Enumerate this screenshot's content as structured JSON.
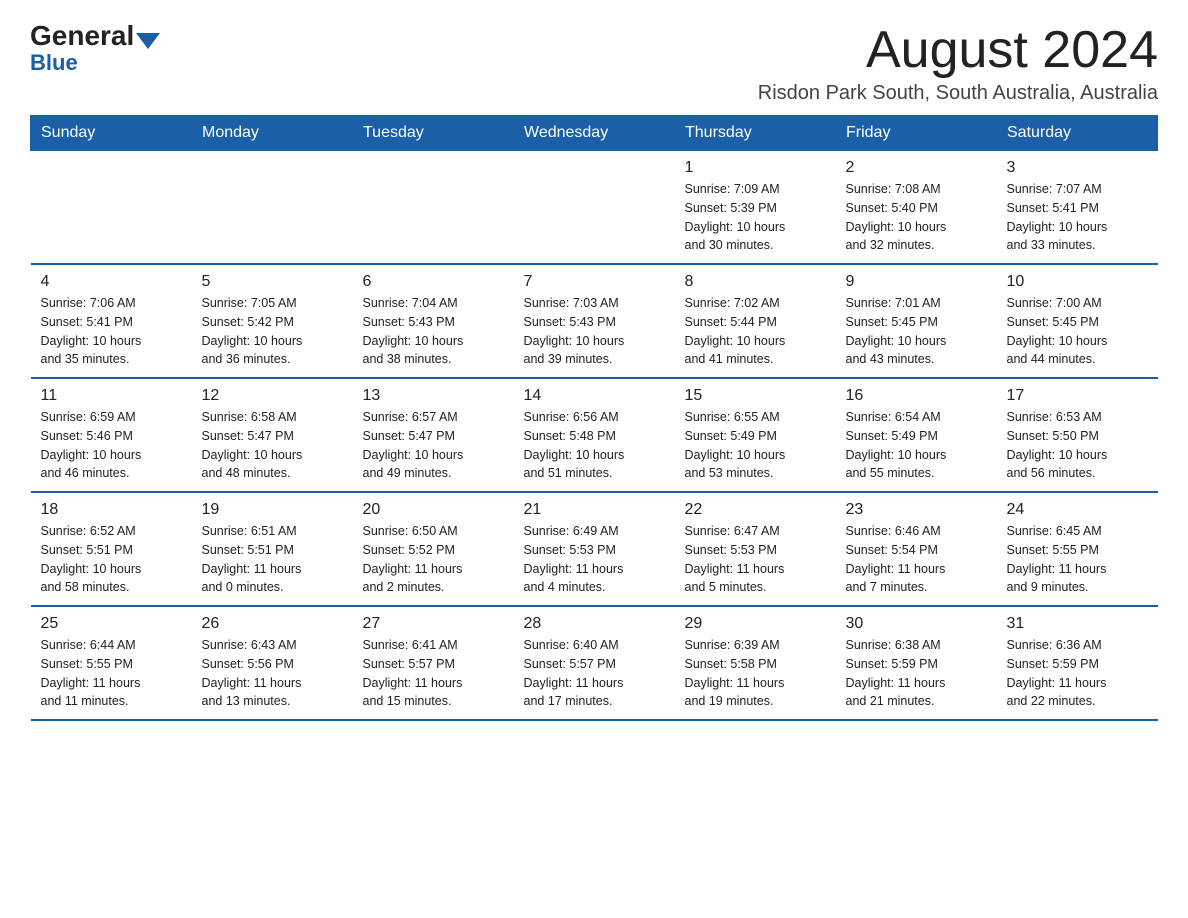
{
  "logo": {
    "general": "General",
    "blue": "Blue"
  },
  "title": "August 2024",
  "location": "Risdon Park South, South Australia, Australia",
  "days_of_week": [
    "Sunday",
    "Monday",
    "Tuesday",
    "Wednesday",
    "Thursday",
    "Friday",
    "Saturday"
  ],
  "weeks": [
    [
      {
        "day": "",
        "info": ""
      },
      {
        "day": "",
        "info": ""
      },
      {
        "day": "",
        "info": ""
      },
      {
        "day": "",
        "info": ""
      },
      {
        "day": "1",
        "info": "Sunrise: 7:09 AM\nSunset: 5:39 PM\nDaylight: 10 hours\nand 30 minutes."
      },
      {
        "day": "2",
        "info": "Sunrise: 7:08 AM\nSunset: 5:40 PM\nDaylight: 10 hours\nand 32 minutes."
      },
      {
        "day": "3",
        "info": "Sunrise: 7:07 AM\nSunset: 5:41 PM\nDaylight: 10 hours\nand 33 minutes."
      }
    ],
    [
      {
        "day": "4",
        "info": "Sunrise: 7:06 AM\nSunset: 5:41 PM\nDaylight: 10 hours\nand 35 minutes."
      },
      {
        "day": "5",
        "info": "Sunrise: 7:05 AM\nSunset: 5:42 PM\nDaylight: 10 hours\nand 36 minutes."
      },
      {
        "day": "6",
        "info": "Sunrise: 7:04 AM\nSunset: 5:43 PM\nDaylight: 10 hours\nand 38 minutes."
      },
      {
        "day": "7",
        "info": "Sunrise: 7:03 AM\nSunset: 5:43 PM\nDaylight: 10 hours\nand 39 minutes."
      },
      {
        "day": "8",
        "info": "Sunrise: 7:02 AM\nSunset: 5:44 PM\nDaylight: 10 hours\nand 41 minutes."
      },
      {
        "day": "9",
        "info": "Sunrise: 7:01 AM\nSunset: 5:45 PM\nDaylight: 10 hours\nand 43 minutes."
      },
      {
        "day": "10",
        "info": "Sunrise: 7:00 AM\nSunset: 5:45 PM\nDaylight: 10 hours\nand 44 minutes."
      }
    ],
    [
      {
        "day": "11",
        "info": "Sunrise: 6:59 AM\nSunset: 5:46 PM\nDaylight: 10 hours\nand 46 minutes."
      },
      {
        "day": "12",
        "info": "Sunrise: 6:58 AM\nSunset: 5:47 PM\nDaylight: 10 hours\nand 48 minutes."
      },
      {
        "day": "13",
        "info": "Sunrise: 6:57 AM\nSunset: 5:47 PM\nDaylight: 10 hours\nand 49 minutes."
      },
      {
        "day": "14",
        "info": "Sunrise: 6:56 AM\nSunset: 5:48 PM\nDaylight: 10 hours\nand 51 minutes."
      },
      {
        "day": "15",
        "info": "Sunrise: 6:55 AM\nSunset: 5:49 PM\nDaylight: 10 hours\nand 53 minutes."
      },
      {
        "day": "16",
        "info": "Sunrise: 6:54 AM\nSunset: 5:49 PM\nDaylight: 10 hours\nand 55 minutes."
      },
      {
        "day": "17",
        "info": "Sunrise: 6:53 AM\nSunset: 5:50 PM\nDaylight: 10 hours\nand 56 minutes."
      }
    ],
    [
      {
        "day": "18",
        "info": "Sunrise: 6:52 AM\nSunset: 5:51 PM\nDaylight: 10 hours\nand 58 minutes."
      },
      {
        "day": "19",
        "info": "Sunrise: 6:51 AM\nSunset: 5:51 PM\nDaylight: 11 hours\nand 0 minutes."
      },
      {
        "day": "20",
        "info": "Sunrise: 6:50 AM\nSunset: 5:52 PM\nDaylight: 11 hours\nand 2 minutes."
      },
      {
        "day": "21",
        "info": "Sunrise: 6:49 AM\nSunset: 5:53 PM\nDaylight: 11 hours\nand 4 minutes."
      },
      {
        "day": "22",
        "info": "Sunrise: 6:47 AM\nSunset: 5:53 PM\nDaylight: 11 hours\nand 5 minutes."
      },
      {
        "day": "23",
        "info": "Sunrise: 6:46 AM\nSunset: 5:54 PM\nDaylight: 11 hours\nand 7 minutes."
      },
      {
        "day": "24",
        "info": "Sunrise: 6:45 AM\nSunset: 5:55 PM\nDaylight: 11 hours\nand 9 minutes."
      }
    ],
    [
      {
        "day": "25",
        "info": "Sunrise: 6:44 AM\nSunset: 5:55 PM\nDaylight: 11 hours\nand 11 minutes."
      },
      {
        "day": "26",
        "info": "Sunrise: 6:43 AM\nSunset: 5:56 PM\nDaylight: 11 hours\nand 13 minutes."
      },
      {
        "day": "27",
        "info": "Sunrise: 6:41 AM\nSunset: 5:57 PM\nDaylight: 11 hours\nand 15 minutes."
      },
      {
        "day": "28",
        "info": "Sunrise: 6:40 AM\nSunset: 5:57 PM\nDaylight: 11 hours\nand 17 minutes."
      },
      {
        "day": "29",
        "info": "Sunrise: 6:39 AM\nSunset: 5:58 PM\nDaylight: 11 hours\nand 19 minutes."
      },
      {
        "day": "30",
        "info": "Sunrise: 6:38 AM\nSunset: 5:59 PM\nDaylight: 11 hours\nand 21 minutes."
      },
      {
        "day": "31",
        "info": "Sunrise: 6:36 AM\nSunset: 5:59 PM\nDaylight: 11 hours\nand 22 minutes."
      }
    ]
  ]
}
